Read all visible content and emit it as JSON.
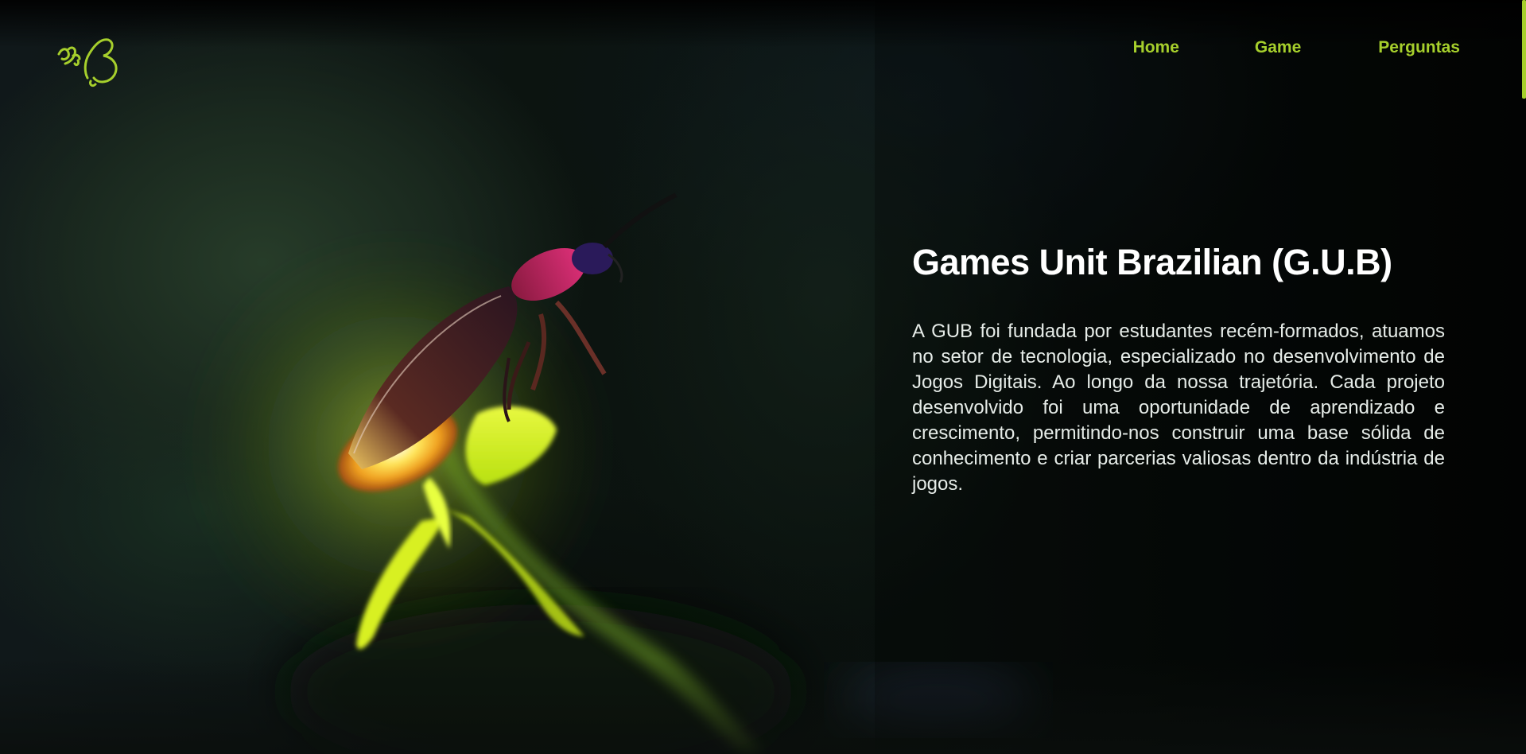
{
  "header": {
    "logo_alt": "GUB logo",
    "nav": [
      {
        "label": "Home"
      },
      {
        "label": "Game"
      },
      {
        "label": "Perguntas"
      }
    ]
  },
  "hero": {
    "title": "Games Unit Brazilian (G.U.B)",
    "description": "A GUB foi fundada por estudantes recém-formados, atuamos no setor de tecnologia, especializado no desenvolvimento de Jogos Digitais. Ao longo da nossa trajetória. Cada projeto desenvolvido foi uma oportunidade de aprendizado e crescimento, permitindo-nos construir uma base sólida de conhecimento e criar parcerias valiosas dentro da indústria de jogos.",
    "background_subject": "firefly-photo"
  },
  "colors": {
    "accent": "#a6cf2c",
    "text": "#ffffff",
    "background": "#050806"
  }
}
